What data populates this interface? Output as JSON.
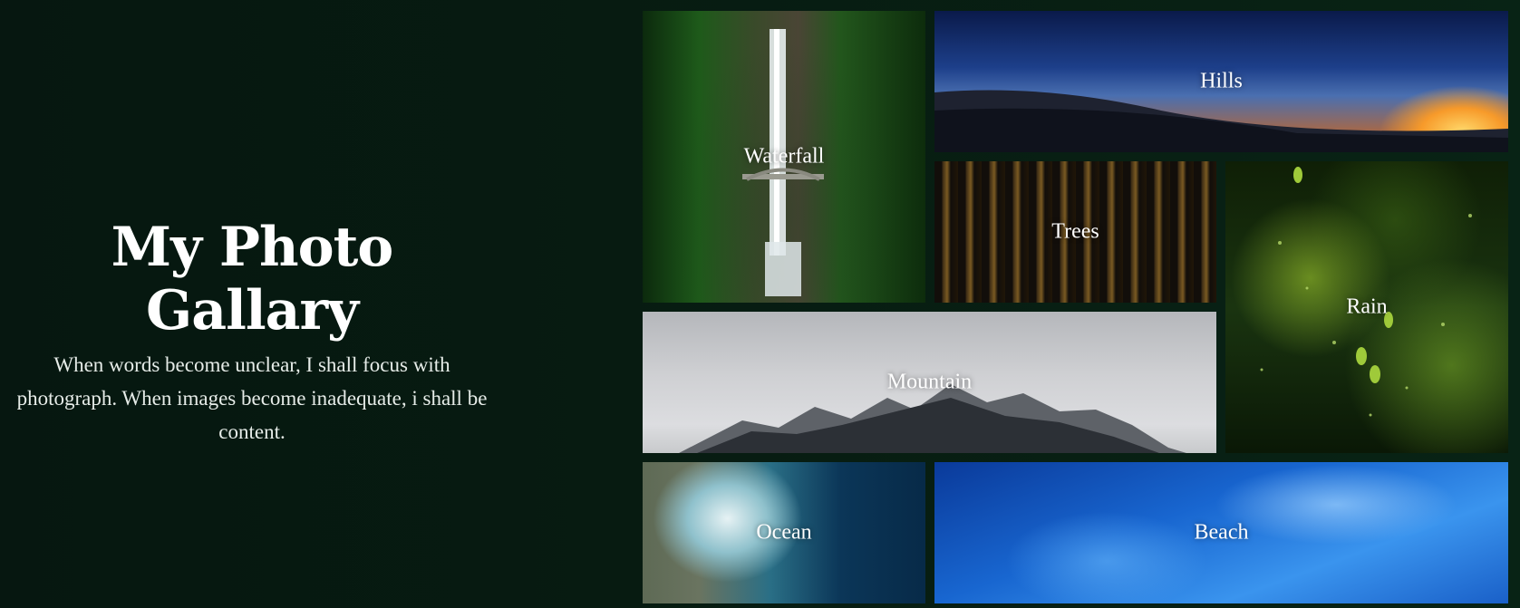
{
  "intro": {
    "title": "My Photo Gallary",
    "description": "When words become unclear, I shall focus with photograph. When images become inadequate, i shall be content."
  },
  "gallery": {
    "tiles": [
      {
        "label": "Waterfall"
      },
      {
        "label": "Hills"
      },
      {
        "label": "Trees"
      },
      {
        "label": "Rain"
      },
      {
        "label": "Mountain"
      },
      {
        "label": "Ocean"
      },
      {
        "label": "Beach"
      }
    ]
  },
  "colors": {
    "background": "#071a10",
    "text": "#ffffff"
  }
}
